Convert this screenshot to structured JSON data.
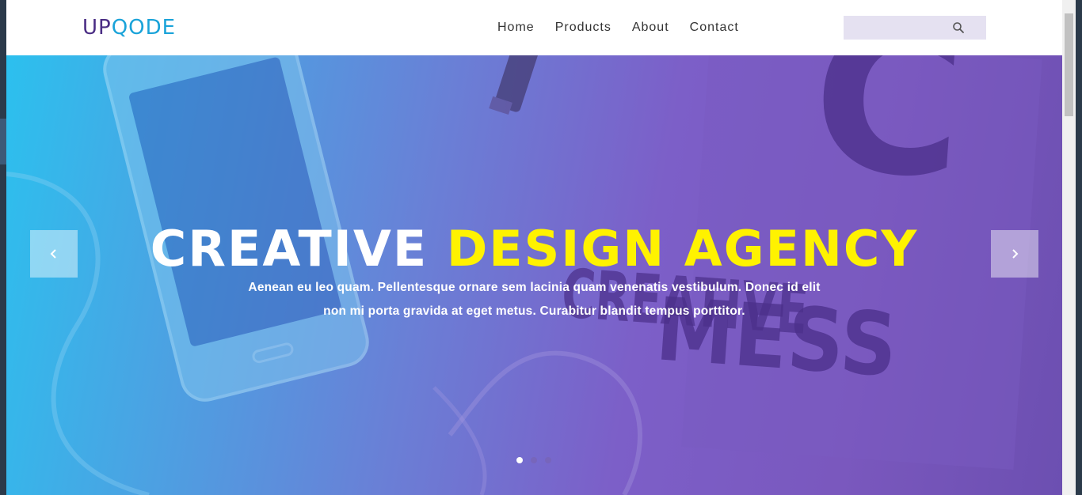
{
  "header": {
    "logo": {
      "part1": "UP",
      "part2": "QODE"
    },
    "nav": [
      "Home",
      "Products",
      "About",
      "Contact"
    ],
    "search": {
      "value": "",
      "placeholder": "",
      "icon": "search-icon"
    }
  },
  "hero": {
    "title_white": "CREATIVE",
    "title_yellow": "DESIGN AGENCY",
    "text_line1": "Aenean eu leo quam. Pellentesque ornare sem lacinia quam venenatis vestibulum. Donec id elit",
    "text_line2": "non mi porta gravida at eget metus. Curabitur blandit tempus porttitor.",
    "prev_icon": "chevron-left-icon",
    "next_icon": "chevron-right-icon",
    "slides": 3,
    "active_slide": 1,
    "background_text": {
      "letter": "C",
      "line1": "CREATIVE",
      "line2": "MESS"
    }
  },
  "colors": {
    "accent_yellow": "#fff200",
    "logo_purple": "#4a2d84",
    "logo_blue": "#1aa3d9",
    "search_bg": "#e5e1f1"
  }
}
